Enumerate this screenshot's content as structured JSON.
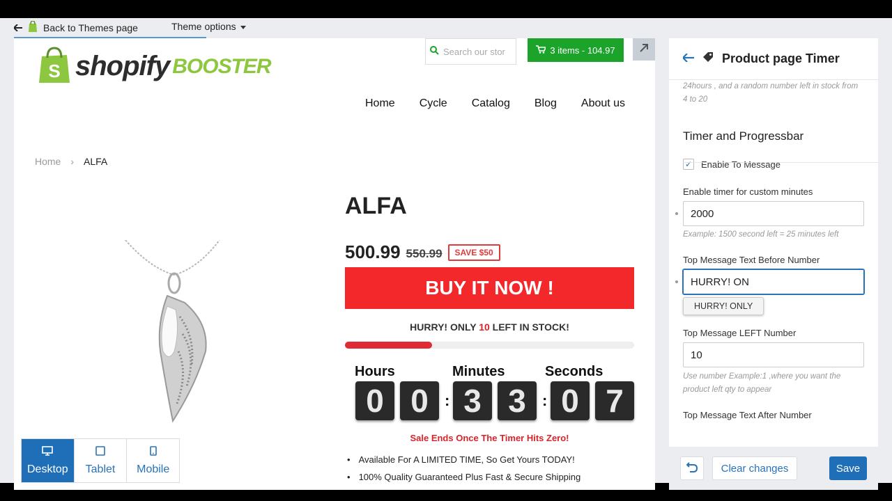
{
  "topbar": {
    "back_label": "Back to Themes page",
    "theme_options_label": "Theme options"
  },
  "header": {
    "logo_text": "shopify",
    "logo_booster": "BOOSTER",
    "search_placeholder": "Search our stor",
    "cart_label": "3 items - 104.97",
    "nav": [
      "Home",
      "Cycle",
      "Catalog",
      "Blog",
      "About us"
    ]
  },
  "breadcrumb": {
    "home": "Home",
    "separator": "›",
    "current": "ALFA"
  },
  "product": {
    "title": "ALFA",
    "price": "500.99",
    "old_price": "550.99",
    "save_badge": "SAVE $50",
    "buy_label": "BUY IT NOW !",
    "stock_before": "HURRY! ONLY",
    "stock_number": "10",
    "stock_after": "LEFT IN STOCK!",
    "stock_progress": 0.3,
    "timer_labels": {
      "hours": "Hours",
      "minutes": "Minutes",
      "seconds": "Seconds"
    },
    "timer_digits": [
      "0",
      "0",
      "3",
      "3",
      "0",
      "7"
    ],
    "sale_end": "Sale Ends Once The Timer Hits Zero!",
    "bullets": [
      "Available For A LIMITED TIME, So Get Yours TODAY!",
      "100% Quality Guaranteed Plus Fast & Secure Shipping"
    ]
  },
  "devices": {
    "desktop": "Desktop",
    "tablet": "Tablet",
    "mobile": "Mobile"
  },
  "panel": {
    "title": "Product page Timer",
    "help_top": "24hours , and a random number left in stock from 4 to 20",
    "section_title": "Timer and Progressbar",
    "enable_msg_label": "Enable To Message",
    "custom_minutes_label": "Enable timer for custom minutes",
    "custom_minutes_value": "2000",
    "custom_minutes_help": "Example: 1500 second left = 25 minutes left",
    "top_msg_before_label": "Top Message Text Before Number",
    "top_msg_before_value": "HURRY! ON",
    "suggestion": "HURRY! ONLY",
    "left_number_label": "Top Message LEFT Number",
    "left_number_value": "10",
    "left_number_help": "Use number Example:1 ,where you want the product left qty to appear",
    "top_msg_after_label": "Top Message Text After Number"
  },
  "footer": {
    "clear_label": "Clear changes",
    "save_label": "Save"
  },
  "colors": {
    "accent": "#1f6fb8",
    "buy": "#f2282a",
    "cart": "#1ca32a",
    "brand_green": "#8dc63f"
  }
}
